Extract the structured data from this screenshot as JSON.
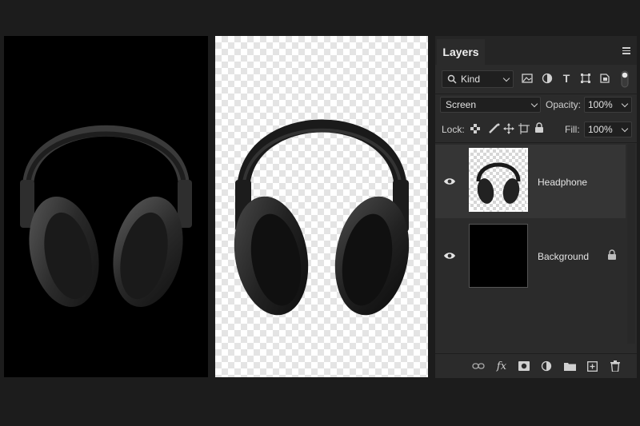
{
  "panel": {
    "title": "Layers",
    "filter": {
      "kind_label": "Kind"
    },
    "blend_mode": "Screen",
    "opacity": {
      "label": "Opacity:",
      "value": "100%"
    },
    "lock": {
      "label": "Lock:"
    },
    "fill": {
      "label": "Fill:",
      "value": "100%"
    },
    "layers": [
      {
        "name": "Headphone",
        "visible": true,
        "selected": true,
        "locked": false
      },
      {
        "name": "Background",
        "visible": true,
        "selected": false,
        "locked": true
      }
    ],
    "footer_icons": [
      "link-icon",
      "fx-icon",
      "mask-icon",
      "adjustment-icon",
      "folder-icon",
      "new-layer-icon",
      "trash-icon"
    ]
  },
  "canvases": [
    {
      "name": "original",
      "background": "#000000"
    },
    {
      "name": "transparent-preview",
      "background": "checkerboard"
    }
  ],
  "colors": {
    "app_bg": "#1c1c1c",
    "panel_bg": "#2b2b2b",
    "selected_row": "#353535"
  }
}
